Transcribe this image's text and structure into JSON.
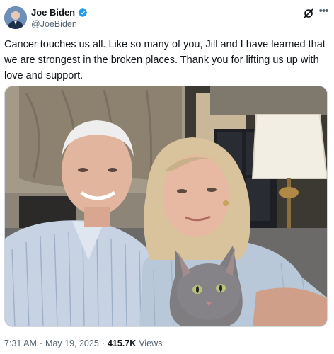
{
  "author": {
    "display_name": "Joe Biden",
    "handle": "@JoeBiden",
    "verified_color": "#1d9bf0"
  },
  "icons": {
    "avatar": "avatar",
    "verified": "verified-badge-icon",
    "grok": "grok-icon",
    "more": "more-icon"
  },
  "tweet": {
    "text": "Cancer touches us all. Like so many of you, Jill and I have learned that we are strongest in the broken places. Thank you for lifting us up with love and support."
  },
  "meta": {
    "time": "7:31 AM",
    "sep1": "·",
    "date": "May 19, 2025",
    "sep2": "·",
    "views_count": "415.7K",
    "views_label": "Views"
  }
}
